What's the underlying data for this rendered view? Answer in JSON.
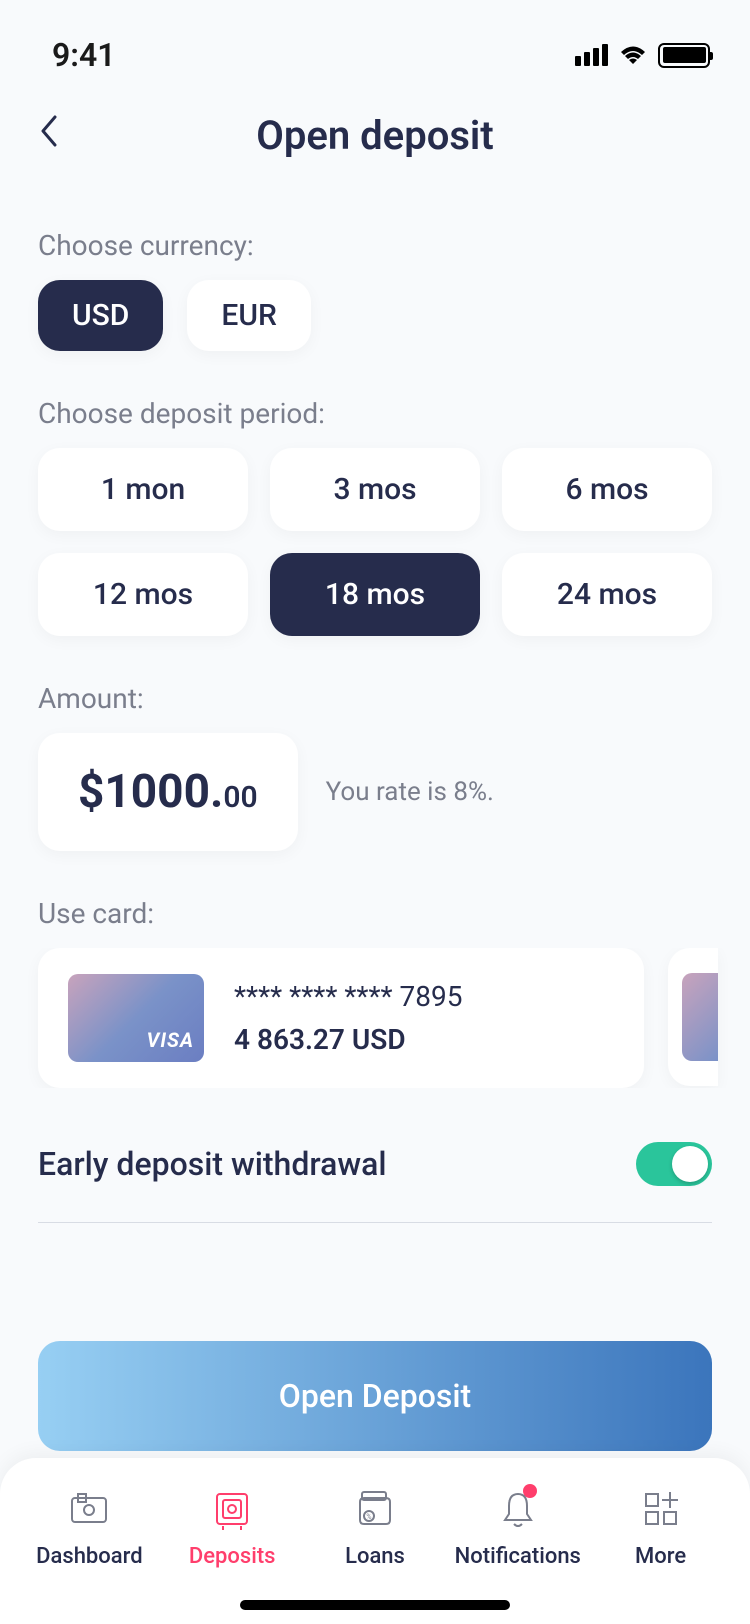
{
  "status": {
    "time": "9:41"
  },
  "header": {
    "title": "Open deposit"
  },
  "currency": {
    "label": "Choose currency:",
    "options": [
      {
        "label": "USD",
        "active": true
      },
      {
        "label": "EUR",
        "active": false
      }
    ]
  },
  "period": {
    "label": "Choose deposit period:",
    "options": [
      {
        "label": "1 mon",
        "active": false
      },
      {
        "label": "3 mos",
        "active": false
      },
      {
        "label": "6 mos",
        "active": false
      },
      {
        "label": "12 mos",
        "active": false
      },
      {
        "label": "18 mos",
        "active": true
      },
      {
        "label": "24 mos",
        "active": false
      }
    ]
  },
  "amount": {
    "label": "Amount:",
    "main": "$1000.",
    "cents": "00",
    "rate_text": "You rate is 8%."
  },
  "card": {
    "label": "Use card:",
    "brand": "VISA",
    "number": "**** **** **** 7895",
    "balance": "4 863.27 USD"
  },
  "withdrawal": {
    "label": "Early deposit withdrawal",
    "on": true
  },
  "cta": {
    "label": "Open Deposit"
  },
  "tabs": [
    {
      "label": "Dashboard"
    },
    {
      "label": "Deposits"
    },
    {
      "label": "Loans"
    },
    {
      "label": "Notifications"
    },
    {
      "label": "More"
    }
  ]
}
